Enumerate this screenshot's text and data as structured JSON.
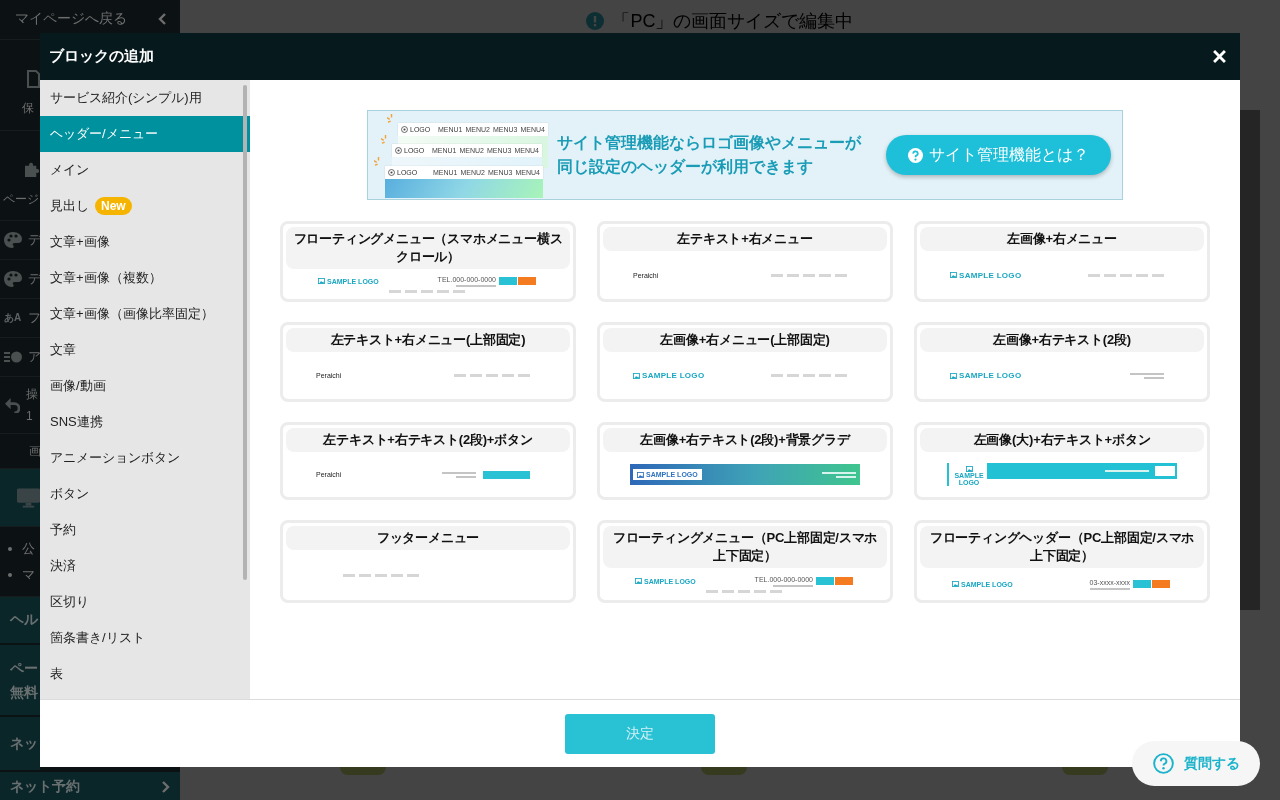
{
  "editor": {
    "back_link": "マイページへ戻る",
    "tools": [
      {
        "kind": "save",
        "lines": [
          "保"
        ]
      },
      {
        "kind": "page",
        "lines": [
          "ページ"
        ]
      },
      {
        "kind": "palette",
        "lines": [
          "デ"
        ]
      },
      {
        "kind": "palette",
        "lines": [
          "デ"
        ]
      },
      {
        "kind": "font",
        "icon_text": "あA",
        "lines": [
          "フ"
        ]
      },
      {
        "kind": "toggle",
        "lines": [
          "ア"
        ]
      },
      {
        "kind": "undo",
        "lines": [
          "操",
          "1"
        ]
      },
      {
        "kind": "caption",
        "lines": [
          "画"
        ]
      },
      {
        "kind": "device"
      },
      {
        "kind": "bullets",
        "lines": [
          "公",
          "マ"
        ]
      },
      {
        "kind": "help",
        "lines": [
          "ヘル"
        ]
      },
      {
        "kind": "promo",
        "lines": [
          "ペー",
          "無料"
        ]
      },
      {
        "kind": "link",
        "lines": [
          "ネッ"
        ]
      },
      {
        "kind": "link_more",
        "lines": [
          "ネット予約"
        ]
      }
    ],
    "notice": "「PC」の画面サイズで編集中"
  },
  "dialog": {
    "title": "ブロックの追加",
    "categories": [
      {
        "label": "サービス紹介(シンプル)用",
        "selected": false
      },
      {
        "label": "ヘッダー/メニュー",
        "selected": true
      },
      {
        "label": "メイン",
        "selected": false
      },
      {
        "label": "見出し",
        "badge": "New",
        "selected": false
      },
      {
        "label": "文章+画像",
        "selected": false
      },
      {
        "label": "文章+画像（複数）",
        "selected": false
      },
      {
        "label": "文章+画像（画像比率固定）",
        "selected": false
      },
      {
        "label": "文章",
        "selected": false
      },
      {
        "label": "画像/動画",
        "selected": false
      },
      {
        "label": "SNS連携",
        "selected": false
      },
      {
        "label": "アニメーションボタン",
        "selected": false
      },
      {
        "label": "ボタン",
        "selected": false
      },
      {
        "label": "予約",
        "selected": false
      },
      {
        "label": "決済",
        "selected": false
      },
      {
        "label": "区切り",
        "selected": false
      },
      {
        "label": "箇条書き/リスト",
        "selected": false
      },
      {
        "label": "表",
        "selected": false
      }
    ],
    "banner": {
      "mockups": [
        {
          "logo": "LOGO",
          "menu": [
            "MENU1",
            "MENU2",
            "MENU3",
            "MENU4"
          ]
        },
        {
          "logo": "LOGO",
          "menu": [
            "MENU1",
            "MENU2",
            "MENU3",
            "MENU4"
          ]
        },
        {
          "logo": "LOGO",
          "menu": [
            "MENU1",
            "MENU2",
            "MENU3",
            "MENU4"
          ]
        }
      ],
      "message": [
        "サイト管理機能ならロゴ画像やメニューが",
        "同じ設定のヘッダーが利用できます"
      ],
      "button": "サイト管理機能とは？"
    },
    "templates": [
      {
        "title": "フローティングメニュー（スマホメニュー横スクロール）",
        "preview": {
          "kind": "floating",
          "logo": "SAMPLE LOGO",
          "phone": "TEL.000-000-0000",
          "buttons": [
            {
              "color": "#29c1d4"
            },
            {
              "color": "#f47b20"
            }
          ]
        }
      },
      {
        "title": "左テキスト+右メニュー",
        "preview": {
          "kind": "text_menu",
          "logo": "Peraichi"
        }
      },
      {
        "title": "左画像+右メニュー",
        "preview": {
          "kind": "logo_menu",
          "logo": "SAMPLE LOGO"
        }
      },
      {
        "title": "左テキスト+右メニュー(上部固定)",
        "preview": {
          "kind": "text_menu",
          "logo": "Peraichi"
        }
      },
      {
        "title": "左画像+右メニュー(上部固定)",
        "preview": {
          "kind": "logo_menu",
          "logo": "SAMPLE LOGO"
        }
      },
      {
        "title": "左画像+右テキスト(2段)",
        "preview": {
          "kind": "logo_text",
          "logo": "SAMPLE LOGO"
        }
      },
      {
        "title": "左テキスト+右テキスト(2段)+ボタン",
        "preview": {
          "kind": "text_text_button",
          "logo": "Peraichi",
          "buttons": [
            {
              "color": "#29c1d4"
            }
          ]
        }
      },
      {
        "title": "左画像+右テキスト(2段)+背景グラデ",
        "preview": {
          "kind": "gradient",
          "logo": "SAMPLE LOGO"
        }
      },
      {
        "title": "左画像(大)+右テキスト+ボタン",
        "preview": {
          "kind": "band",
          "logo": "SAMPLE LOGO",
          "buttons": [
            {
              "color": "#ffffff"
            }
          ]
        }
      },
      {
        "title": "フッターメニュー",
        "preview": {
          "kind": "footer"
        }
      },
      {
        "title": "フローティングメニュー（PC上部固定/スマホ上下固定）",
        "preview": {
          "kind": "floating",
          "logo": "SAMPLE LOGO",
          "phone": "TEL.000-000-0000",
          "buttons": [
            {
              "color": "#29c1d4"
            },
            {
              "color": "#f47b20"
            }
          ]
        }
      },
      {
        "title": "フローティングヘッダー（PC上部固定/スマホ上下固定）",
        "preview": {
          "kind": "floating_header",
          "logo": "SAMPLE LOGO",
          "phone": "03-xxxx-xxxx",
          "buttons": [
            {
              "color": "#29c1d4"
            },
            {
              "color": "#f47b20"
            }
          ]
        }
      }
    ],
    "confirm": "決定"
  },
  "help_button": "質問する"
}
